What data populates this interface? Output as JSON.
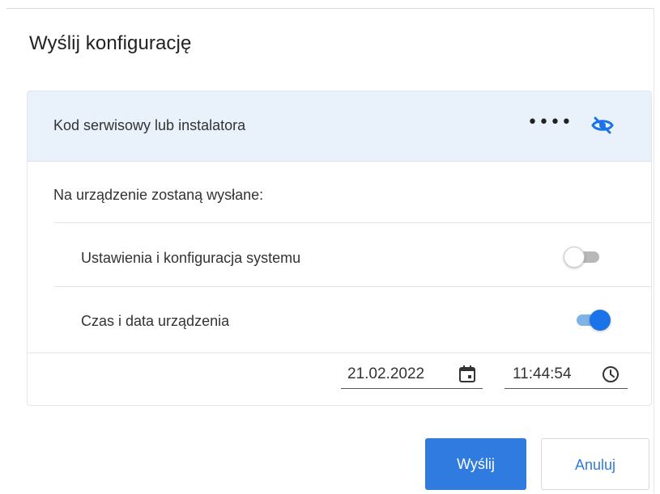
{
  "dialog": {
    "title": "Wyślij konfigurację"
  },
  "code": {
    "label": "Kod serwisowy lub instalatora",
    "masked_value": "••••",
    "visibility_icon": "eye-off-icon"
  },
  "send_section": {
    "label": "Na urządzenie zostaną wysłane:",
    "options": [
      {
        "label": "Ustawienia i konfiguracja systemu",
        "enabled": false
      },
      {
        "label": "Czas i data urządzenia",
        "enabled": true
      }
    ]
  },
  "datetime": {
    "date": "21.02.2022",
    "date_icon": "calendar-icon",
    "time": "11:44:54",
    "time_icon": "clock-icon"
  },
  "actions": {
    "submit_label": "Wyślij",
    "cancel_label": "Anuluj"
  },
  "colors": {
    "accent": "#2f7be0",
    "toggle_on": "#1a73e8",
    "code_row_background": "#e9f2fa"
  }
}
